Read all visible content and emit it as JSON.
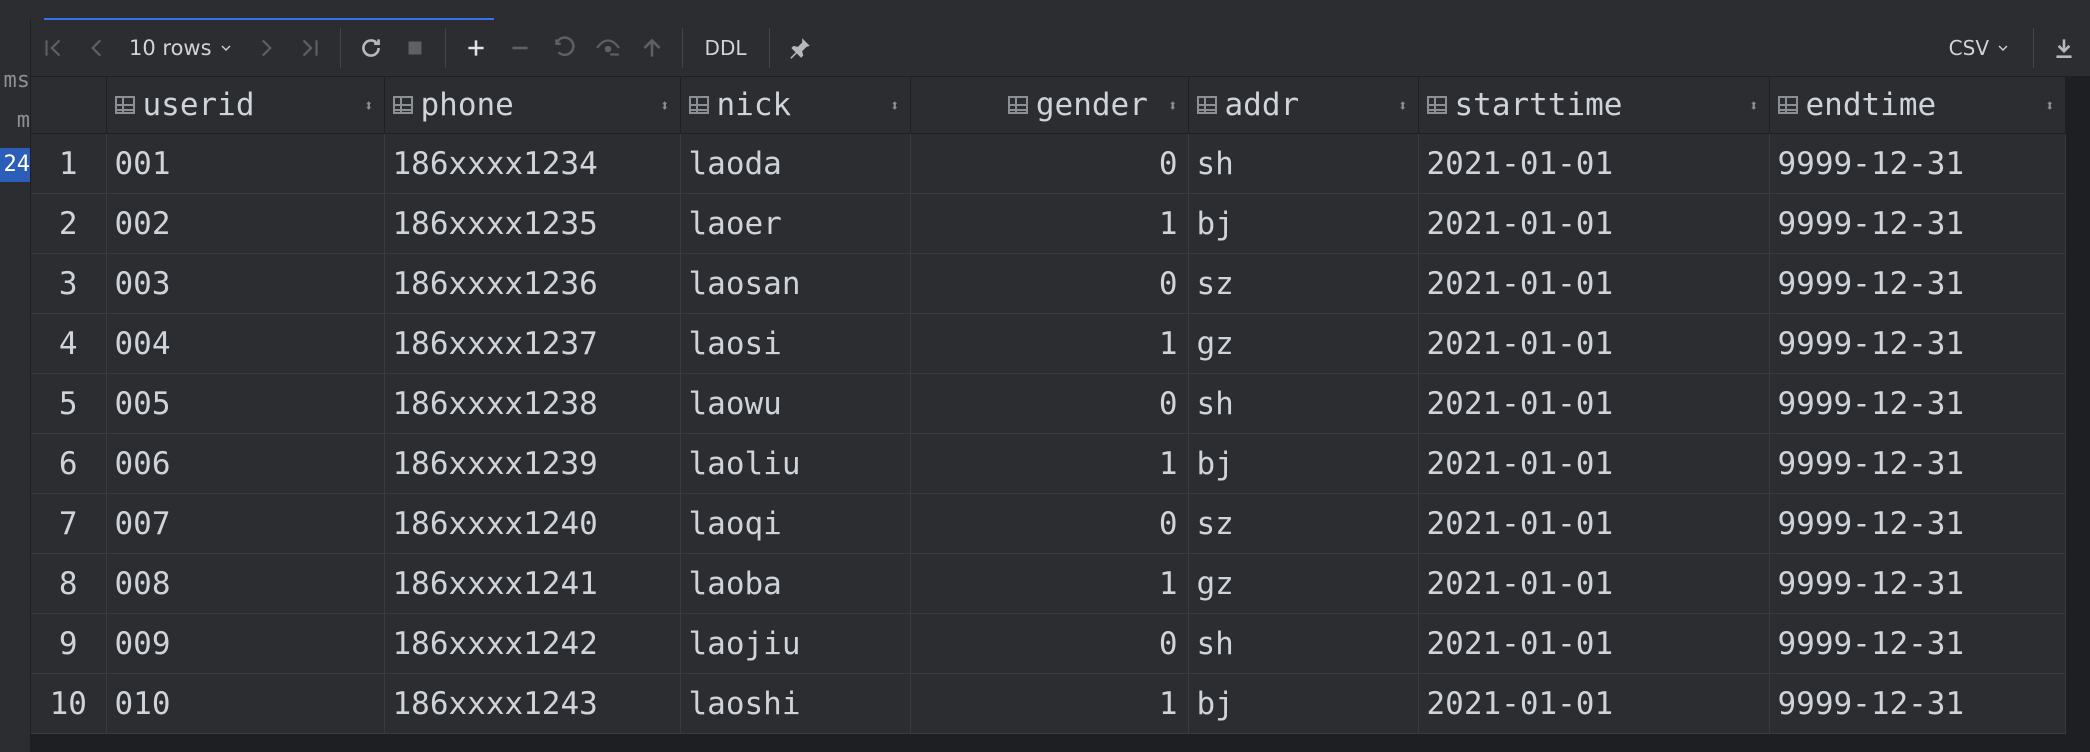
{
  "gutter": {
    "lines": [
      "ms",
      "m",
      "24"
    ]
  },
  "toolbar": {
    "rows_label": "10 rows",
    "ddl_label": "DDL",
    "export_format": "CSV"
  },
  "table": {
    "columns": [
      {
        "name": "userid",
        "align": "left"
      },
      {
        "name": "phone",
        "align": "left"
      },
      {
        "name": "nick",
        "align": "left"
      },
      {
        "name": "gender",
        "align": "right"
      },
      {
        "name": "addr",
        "align": "left"
      },
      {
        "name": "starttime",
        "align": "left"
      },
      {
        "name": "endtime",
        "align": "left"
      }
    ],
    "rows": [
      {
        "n": "1",
        "cells": [
          "001",
          "186xxxx1234",
          "laoda",
          "0",
          "sh",
          "2021-01-01",
          "9999-12-31"
        ]
      },
      {
        "n": "2",
        "cells": [
          "002",
          "186xxxx1235",
          "laoer",
          "1",
          "bj",
          "2021-01-01",
          "9999-12-31"
        ]
      },
      {
        "n": "3",
        "cells": [
          "003",
          "186xxxx1236",
          "laosan",
          "0",
          "sz",
          "2021-01-01",
          "9999-12-31"
        ]
      },
      {
        "n": "4",
        "cells": [
          "004",
          "186xxxx1237",
          "laosi",
          "1",
          "gz",
          "2021-01-01",
          "9999-12-31"
        ]
      },
      {
        "n": "5",
        "cells": [
          "005",
          "186xxxx1238",
          "laowu",
          "0",
          "sh",
          "2021-01-01",
          "9999-12-31"
        ]
      },
      {
        "n": "6",
        "cells": [
          "006",
          "186xxxx1239",
          "laoliu",
          "1",
          "bj",
          "2021-01-01",
          "9999-12-31"
        ]
      },
      {
        "n": "7",
        "cells": [
          "007",
          "186xxxx1240",
          "laoqi",
          "0",
          "sz",
          "2021-01-01",
          "9999-12-31"
        ]
      },
      {
        "n": "8",
        "cells": [
          "008",
          "186xxxx1241",
          "laoba",
          "1",
          "gz",
          "2021-01-01",
          "9999-12-31"
        ]
      },
      {
        "n": "9",
        "cells": [
          "009",
          "186xxxx1242",
          "laojiu",
          "0",
          "sh",
          "2021-01-01",
          "9999-12-31"
        ]
      },
      {
        "n": "10",
        "cells": [
          "010",
          "186xxxx1243",
          "laoshi",
          "1",
          "bj",
          "2021-01-01",
          "9999-12-31"
        ]
      }
    ]
  },
  "colors": {
    "accent": "#3574f0",
    "selection": "#2c5eb9",
    "background": "#2b2d30"
  }
}
